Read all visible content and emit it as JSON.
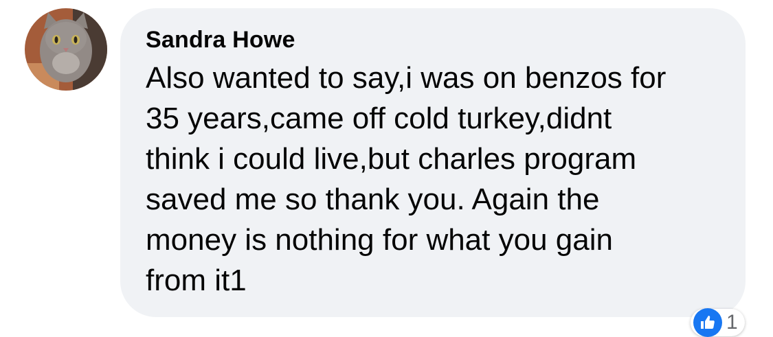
{
  "comment": {
    "author": "Sandra Howe",
    "text": "Also wanted to say,i was on benzos for\n35 years,came off cold turkey,didnt\nthink i could live,but charles program\nsaved me so thank you. Again the\nmoney is nothing for what you gain\nfrom it1",
    "reaction_count": "1",
    "avatar_icon": "cat-photo-avatar",
    "reaction_icon": "like-thumbs-up-icon"
  },
  "colors": {
    "bubble_background": "#f0f2f5",
    "text": "#050505",
    "like_blue": "#1877f2"
  }
}
